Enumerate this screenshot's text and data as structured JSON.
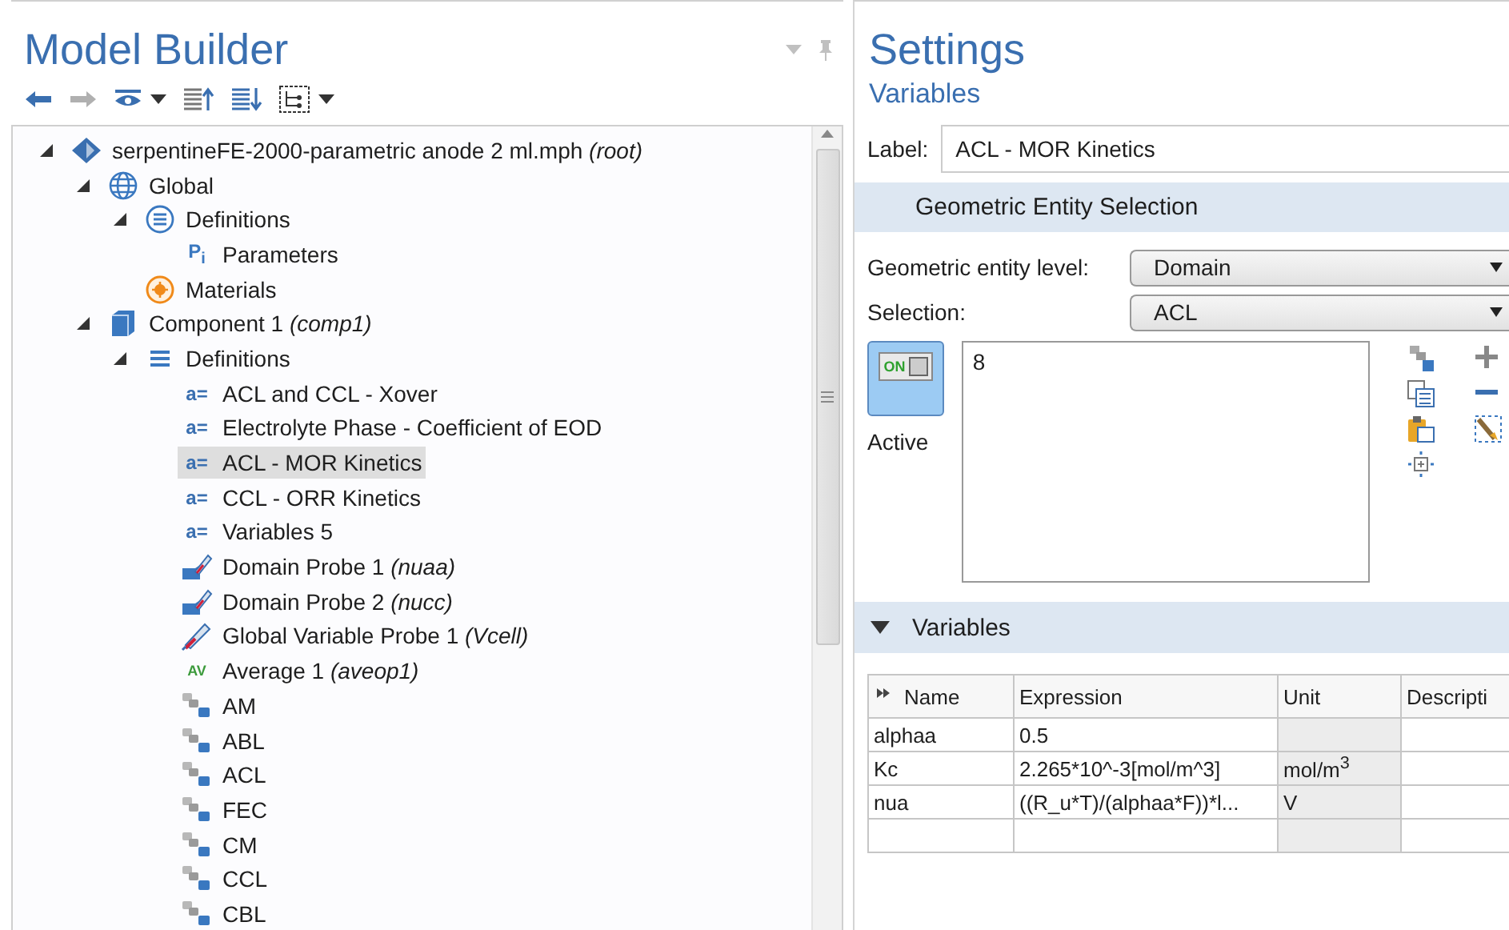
{
  "model_builder": {
    "title": "Model Builder",
    "toolbar": [
      {
        "kind": "back",
        "disabled": false
      },
      {
        "kind": "forward",
        "disabled": true
      },
      {
        "kind": "show",
        "disabled": false
      },
      {
        "kind": "dropdown",
        "disabled": false
      },
      {
        "kind": "collapse",
        "disabled": false
      },
      {
        "kind": "expand",
        "disabled": false
      },
      {
        "kind": "tree",
        "disabled": false
      },
      {
        "kind": "dropdown",
        "disabled": false
      }
    ],
    "tree": [
      {
        "label": "serpentineFE-2000-parametric anode 2 ml.mph *(root)*",
        "kind": "model",
        "expanded": true,
        "selected": false,
        "children": [
          {
            "label": "Global",
            "kind": "global",
            "expanded": true,
            "selected": false,
            "children": [
              {
                "label": "Definitions",
                "kind": "global-definitions",
                "expanded": true,
                "selected": false,
                "children": [
                  {
                    "label": "Parameters",
                    "kind": "parameters",
                    "glyph": "P$_{i}$",
                    "selected": false
                  }
                ]
              },
              {
                "label": "Materials",
                "kind": "materials",
                "selected": false
              }
            ]
          },
          {
            "label": "Component 1 *(comp1)*",
            "kind": "component",
            "expanded": true,
            "selected": false,
            "children": [
              {
                "label": "Definitions",
                "kind": "definitions",
                "expanded": true,
                "selected": false,
                "children": [
                  {
                    "label": "ACL and CCL - Xover",
                    "kind": "variables",
                    "glyph": "a=",
                    "selected": false
                  },
                  {
                    "label": "Electrolyte Phase - Coefficient of EOD",
                    "kind": "variables",
                    "glyph": "a=",
                    "selected": false
                  },
                  {
                    "label": "ACL - MOR Kinetics",
                    "kind": "variables",
                    "glyph": "a=",
                    "selected": true
                  },
                  {
                    "label": "CCL - ORR Kinetics",
                    "kind": "variables",
                    "glyph": "a=",
                    "selected": false
                  },
                  {
                    "label": "Variables 5",
                    "kind": "variables",
                    "glyph": "a=",
                    "selected": false
                  },
                  {
                    "label": "Domain Probe 1 *(nuaa)*",
                    "kind": "domain-probe",
                    "selected": false
                  },
                  {
                    "label": "Domain Probe 2 *(nucc)*",
                    "kind": "domain-probe",
                    "selected": false
                  },
                  {
                    "label": "Global Variable Probe 1 *(Vcell)*",
                    "kind": "global-probe",
                    "selected": false
                  },
                  {
                    "label": "Average 1 *(aveop1)*",
                    "kind": "average",
                    "glyph": "AV",
                    "selected": false
                  },
                  {
                    "label": "AM",
                    "kind": "selection",
                    "selected": false
                  },
                  {
                    "label": "ABL",
                    "kind": "selection",
                    "selected": false
                  },
                  {
                    "label": "ACL",
                    "kind": "selection",
                    "selected": false
                  },
                  {
                    "label": "FEC",
                    "kind": "selection",
                    "selected": false
                  },
                  {
                    "label": "CM",
                    "kind": "selection",
                    "selected": false
                  },
                  {
                    "label": "CCL",
                    "kind": "selection",
                    "selected": false
                  },
                  {
                    "label": "CBL",
                    "kind": "selection",
                    "selected": false
                  }
                ]
              }
            ]
          }
        ]
      }
    ]
  },
  "settings": {
    "title": "Settings",
    "subtitle": "Variables",
    "label_field": {
      "label": "Label:",
      "value": "ACL - MOR Kinetics"
    },
    "entity_section": {
      "title": "Geometric Entity Selection",
      "fields": [
        {
          "label": "Geometric entity level:",
          "value": "Domain"
        },
        {
          "label": "Selection:",
          "value": "ACL"
        }
      ],
      "active": {
        "switch_text": "ON",
        "label": "Active",
        "on": true
      },
      "selection_list": [
        "8"
      ]
    },
    "variables_section": {
      "title": "Variables",
      "expanded": true,
      "columns": [
        "Name",
        "Expression",
        "Unit",
        "Descripti"
      ],
      "rows": [
        {
          "name": "alphaa",
          "expression": "0.5"
        },
        {
          "name": "Kc",
          "expression": "2.265*10^-3[mol/m^3]",
          "unit": "mol/m$^{3}$"
        },
        {
          "name": "nua",
          "expression": "((R_u*T)/(alphaa*F))*l...",
          "unit": "V"
        }
      ]
    }
  }
}
